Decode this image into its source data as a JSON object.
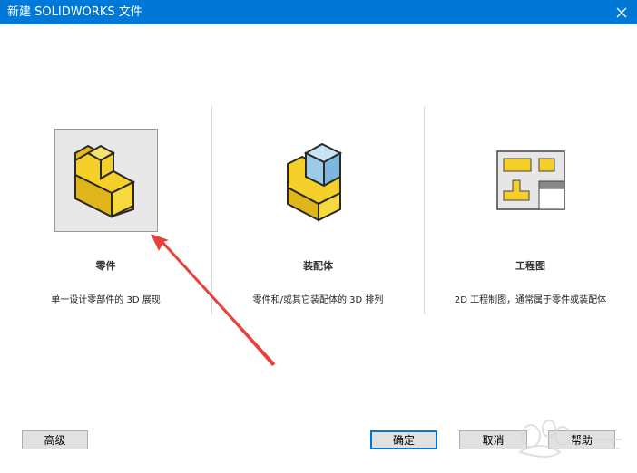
{
  "window": {
    "title": "新建 SOLIDWORKS 文件"
  },
  "options": [
    {
      "title": "零件",
      "description": "单一设计零部件的 3D 展现"
    },
    {
      "title": "装配体",
      "description": "零件和/或其它装配体的 3D 排列"
    },
    {
      "title": "工程图",
      "description": "2D 工程制图，通常属于零件或装配体"
    }
  ],
  "buttons": {
    "advanced": "高级",
    "ok": "确定",
    "cancel": "取消",
    "help": "帮助"
  },
  "colors": {
    "titlebar": "#0078d7",
    "part_yellow": "#f5d02a",
    "assembly_blue": "#9ccbe8",
    "arrow_red": "#e8413c"
  }
}
